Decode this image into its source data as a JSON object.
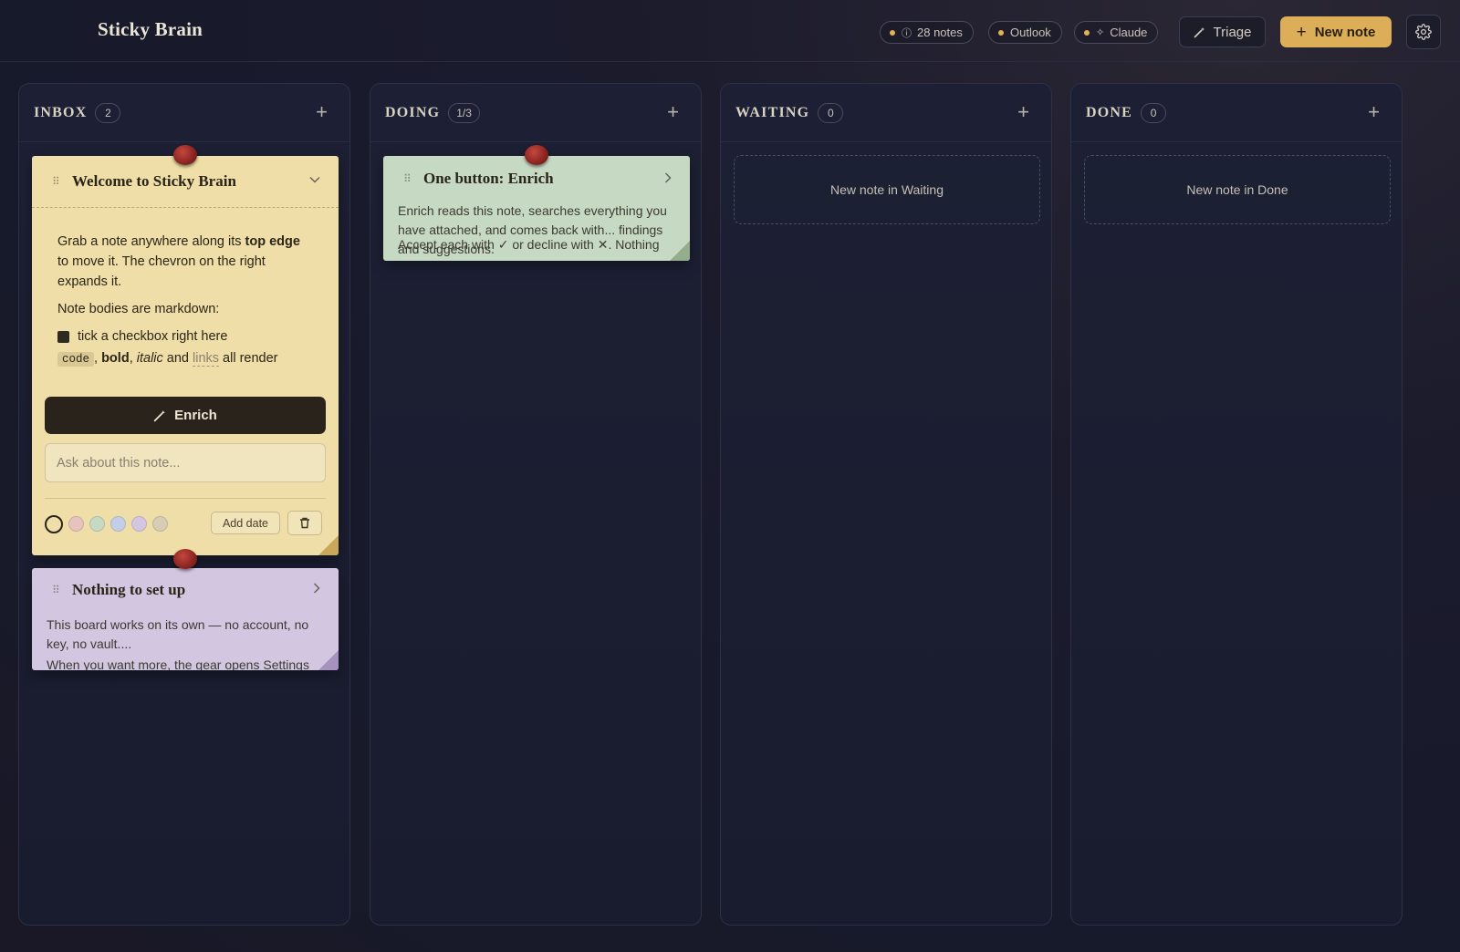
{
  "app": {
    "title": "Sticky Brain"
  },
  "header": {
    "notes_pill": "28 notes",
    "notes_icon": "ⓘ",
    "outlook_pill": "Outlook",
    "claude_pill": "Claude",
    "claude_icon": "✧",
    "triage_label": "Triage",
    "new_note_label": "New note",
    "status_dot_color": "#e2b24f",
    "accent_color": "#dcae57"
  },
  "columns": [
    {
      "title": "INBOX",
      "count": "2",
      "add": "+"
    },
    {
      "title": "DOING",
      "count": "1/3",
      "add": "+",
      "empty_label": ""
    },
    {
      "title": "WAITING",
      "count": "0",
      "add": "+",
      "empty_label": "New note in Waiting"
    },
    {
      "title": "DONE",
      "count": "0",
      "add": "+",
      "empty_label": "New note in Done"
    }
  ],
  "notes": {
    "welcome": {
      "title": "Welcome to Sticky Brain",
      "p1_a": "Grab a note anywhere along its ",
      "p1_b": "top edge",
      "p1_c": " to move it. The chevron on the right expands it.",
      "p2": "Note bodies are markdown:",
      "checkbox_text": "tick a checkbox right here",
      "md_code": "code",
      "md_sep1": ", ",
      "md_bold": "bold",
      "md_sep2": ", ",
      "md_italic": "italic",
      "md_and": " and ",
      "md_links": "links",
      "md_end": " all render",
      "enrich_label": "Enrich",
      "ask_placeholder": "Ask about this note...",
      "add_date_label": "Add date",
      "swatches": [
        "#efdea8",
        "#e8c2bc",
        "#c6d9c2",
        "#c3cfe6",
        "#d2c6e0",
        "#d7ccb4"
      ]
    },
    "setup": {
      "title": "Nothing to set up",
      "line1": "This board works on its own — no account, no key, no vault....",
      "line2": "When you want more, the gear opens Settings"
    },
    "enrich": {
      "title": "One button: Enrich",
      "line1": "Enrich reads this note, searches everything you have attached, and comes back with... findings and suggestions.",
      "line2": "Accept each with ✓ or decline with ✕. Nothing"
    }
  }
}
